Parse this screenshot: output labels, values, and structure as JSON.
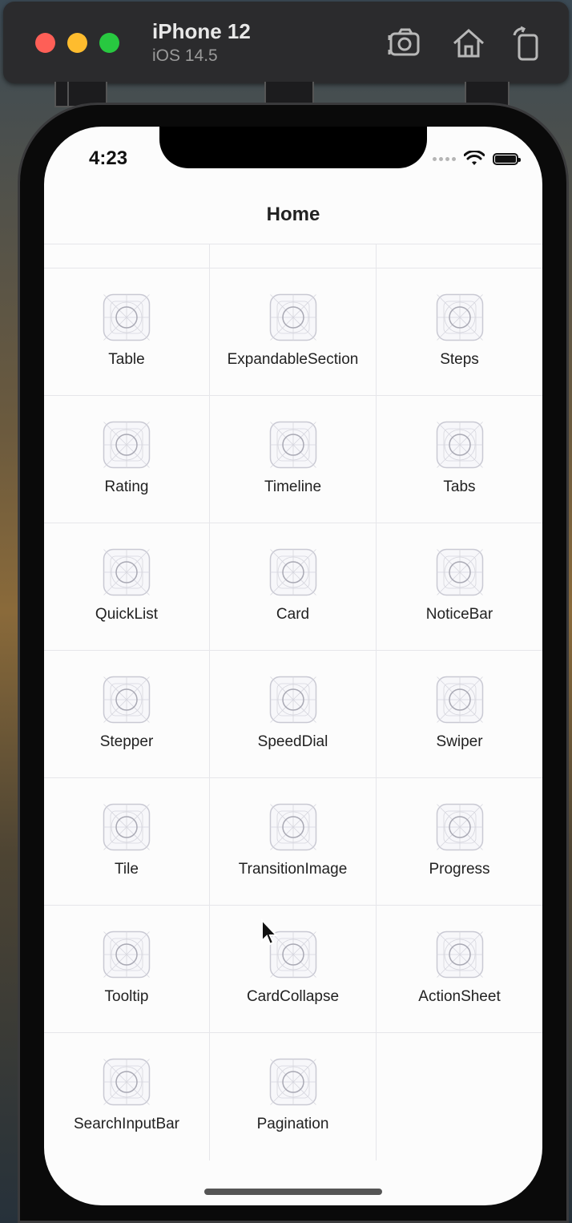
{
  "simulator": {
    "device_name": "iPhone 12",
    "os_version": "iOS 14.5"
  },
  "status_bar": {
    "time": "4:23"
  },
  "nav": {
    "title": "Home"
  },
  "grid_items": [
    {
      "label": "Table"
    },
    {
      "label": "ExpandableSection"
    },
    {
      "label": "Steps"
    },
    {
      "label": "Rating"
    },
    {
      "label": "Timeline"
    },
    {
      "label": "Tabs"
    },
    {
      "label": "QuickList"
    },
    {
      "label": "Card"
    },
    {
      "label": "NoticeBar"
    },
    {
      "label": "Stepper"
    },
    {
      "label": "SpeedDial"
    },
    {
      "label": "Swiper"
    },
    {
      "label": "Tile"
    },
    {
      "label": "TransitionImage"
    },
    {
      "label": "Progress"
    },
    {
      "label": "Tooltip"
    },
    {
      "label": "CardCollapse"
    },
    {
      "label": "ActionSheet"
    },
    {
      "label": "SearchInputBar"
    },
    {
      "label": "Pagination"
    }
  ],
  "colors": {
    "traffic_red": "#fe5f57",
    "traffic_yellow": "#febc2e",
    "traffic_green": "#28c840",
    "screen_bg": "#fcfcfc",
    "grid_line": "#e6e6ea"
  }
}
